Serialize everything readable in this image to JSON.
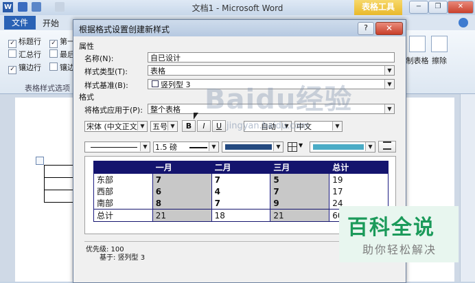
{
  "titlebar": {
    "title": "文档1 - Microsoft Word",
    "contextual_tab": "表格工具",
    "minimize": "−",
    "restore": "❐",
    "close": "✕"
  },
  "ribbon_tabs": {
    "file": "文件",
    "home": "开始"
  },
  "ribbon": {
    "options": [
      {
        "label": "标题行",
        "checked": true
      },
      {
        "label": "第一",
        "checked": true
      },
      {
        "label": "汇总行",
        "checked": false
      },
      {
        "label": "最后",
        "checked": false
      },
      {
        "label": "镶边行",
        "checked": true
      },
      {
        "label": "镶边",
        "checked": false
      }
    ],
    "group_label": "表格样式选项",
    "draw_table": "制表格",
    "eraser": "擦除"
  },
  "dialog": {
    "title": "根据格式设置创建新样式",
    "help": "?",
    "close": "✕",
    "properties_section": "属性",
    "name_label": "名称(N):",
    "name_value": "自已设计",
    "style_type_label": "样式类型(T):",
    "style_type_value": "表格",
    "style_based_label": "样式基准(B):",
    "style_based_value": "竖列型 3",
    "format_section": "格式",
    "apply_to_label": "将格式应用于(P):",
    "apply_to_value": "整个表格",
    "font_value": "宋体 (中文正文",
    "size_value": "五号",
    "bold": "B",
    "italic": "I",
    "underline": "U",
    "color_value": "自动",
    "lang_value": "中文",
    "line_width_value": "1.5 磅",
    "priority_text": "优先级: 100",
    "based_on_text": "基于: 竖列型 3"
  },
  "preview": {
    "headers": [
      "",
      "一月",
      "二月",
      "三月",
      "总计"
    ],
    "rows": [
      [
        "东部",
        "7",
        "7",
        "5",
        "19"
      ],
      [
        "西部",
        "6",
        "4",
        "7",
        "17"
      ],
      [
        "南部",
        "8",
        "7",
        "9",
        "24"
      ],
      [
        "总计",
        "21",
        "18",
        "21",
        "60"
      ]
    ]
  },
  "colors": {
    "header_fill": "#14146e",
    "shade": "#c8c8c8",
    "swatch_blue": "#244a80",
    "swatch_teal": "#4bacc6",
    "brand_green": "#1b9a5a"
  },
  "watermark": {
    "logo": "Baidu经验",
    "url": "jingyan.baidu.com"
  },
  "brand": {
    "main": "百科全说",
    "sub": "助你轻松解决"
  }
}
